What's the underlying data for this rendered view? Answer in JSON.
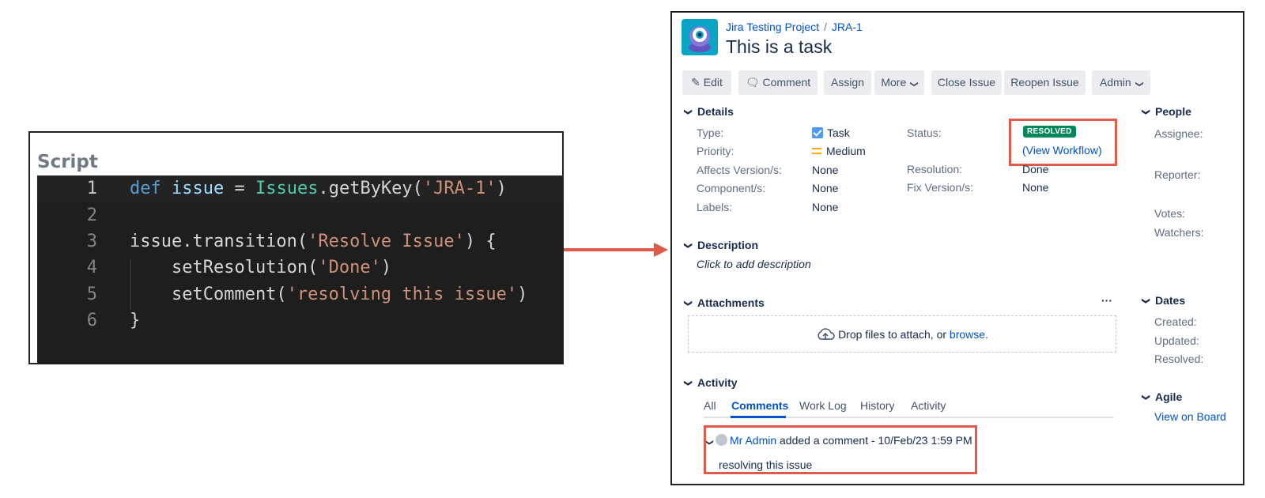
{
  "script_panel": {
    "title": "Script",
    "lines": [
      {
        "num": "1",
        "tokens": [
          {
            "t": "def",
            "c": "kw"
          },
          {
            "t": " ",
            "c": "pln"
          },
          {
            "t": "issue",
            "c": "var"
          },
          {
            "t": " = ",
            "c": "pln"
          },
          {
            "t": "Issues",
            "c": "cls"
          },
          {
            "t": ".getByKey(",
            "c": "pln"
          },
          {
            "t": "'JRA-1'",
            "c": "str"
          },
          {
            "t": ")",
            "c": "pln"
          }
        ]
      },
      {
        "num": "2",
        "tokens": []
      },
      {
        "num": "3",
        "tokens": [
          {
            "t": "issue.transition(",
            "c": "pln"
          },
          {
            "t": "'Resolve Issue'",
            "c": "str"
          },
          {
            "t": ") {",
            "c": "pln"
          }
        ]
      },
      {
        "num": "4",
        "tokens": [
          {
            "t": "    setResolution(",
            "c": "pln"
          },
          {
            "t": "'Done'",
            "c": "str"
          },
          {
            "t": ")",
            "c": "pln"
          }
        ]
      },
      {
        "num": "5",
        "tokens": [
          {
            "t": "    setComment(",
            "c": "pln"
          },
          {
            "t": "'resolving this issue'",
            "c": "str"
          },
          {
            "t": ")",
            "c": "pln"
          }
        ]
      },
      {
        "num": "6",
        "tokens": [
          {
            "t": "}",
            "c": "pln"
          }
        ]
      }
    ]
  },
  "colors": {
    "arrow": "#e05a4a",
    "highlight_box": "#e05a4a",
    "link": "#0052cc",
    "resolved_badge": "#00875a"
  },
  "jira": {
    "breadcrumb": {
      "project": "Jira Testing Project",
      "separator": "/",
      "issue_key": "JRA-1"
    },
    "title": "This is a task",
    "toolbar": {
      "edit": "Edit",
      "comment": "Comment",
      "assign": "Assign",
      "more": "More",
      "close_issue": "Close Issue",
      "reopen_issue": "Reopen Issue",
      "admin": "Admin"
    },
    "details": {
      "heading": "Details",
      "type_label": "Type:",
      "type_value": "Task",
      "priority_label": "Priority:",
      "priority_value": "Medium",
      "affects_label": "Affects Version/s:",
      "affects_value": "None",
      "component_label": "Component/s:",
      "component_value": "None",
      "labels_label": "Labels:",
      "labels_value": "None",
      "status_label": "Status:",
      "status_value": "RESOLVED",
      "view_workflow": "(View Workflow)",
      "resolution_label": "Resolution:",
      "resolution_value": "Done",
      "fix_label": "Fix Version/s:",
      "fix_value": "None"
    },
    "description": {
      "heading": "Description",
      "placeholder": "Click to add description"
    },
    "attachments": {
      "heading": "Attachments",
      "more": "···",
      "drop_text": "Drop files to attach, or ",
      "browse": "browse."
    },
    "activity": {
      "heading": "Activity",
      "tabs": [
        "All",
        "Comments",
        "Work Log",
        "History",
        "Activity"
      ],
      "comment_author": "Mr Admin",
      "comment_meta": " added a comment - 10/Feb/23 1:59 PM",
      "comment_body": "resolving this issue"
    },
    "people": {
      "heading": "People",
      "assignee": "Assignee:",
      "reporter": "Reporter:",
      "votes": "Votes:",
      "watchers": "Watchers:"
    },
    "dates": {
      "heading": "Dates",
      "created": "Created:",
      "updated": "Updated:",
      "resolved": "Resolved:"
    },
    "agile": {
      "heading": "Agile",
      "view_on_board": "View on Board"
    }
  }
}
